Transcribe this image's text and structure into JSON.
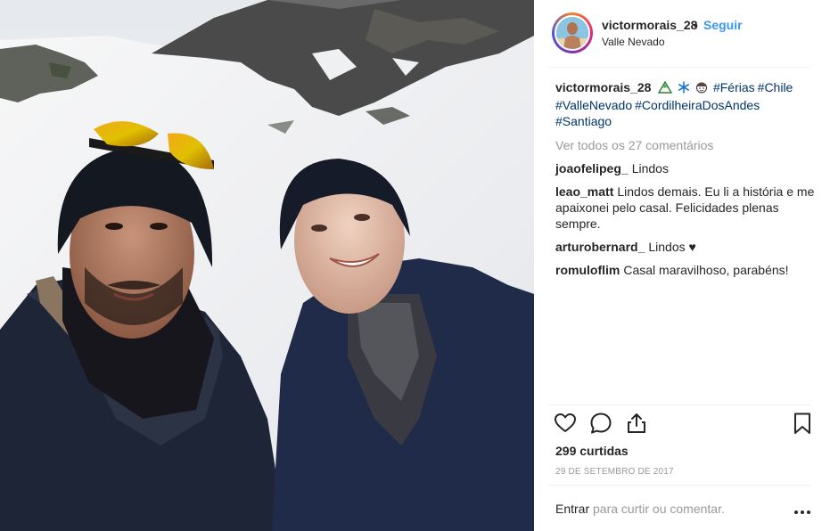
{
  "header": {
    "username": "victormorais_28",
    "separator": "•",
    "follow_label": "Seguir",
    "location": "Valle Nevado"
  },
  "caption": {
    "username": "victormorais_28",
    "emojis": [
      "mountain-emoji",
      "snowflake-emoji",
      "man-emoji"
    ],
    "hashtags": [
      "#Férias",
      "#Chile",
      "#ValleNevado",
      "#CordilheiraDosAndes",
      "#Santiago"
    ]
  },
  "comments": {
    "view_all": "Ver todos os 27 comentários",
    "items": [
      {
        "user": "joaofelipeg_",
        "text": "Lindos"
      },
      {
        "user": "leao_matt",
        "text": "Lindos demais. Eu li a história e me apaixonei pelo casal. Felicidades plenas sempre."
      },
      {
        "user": "arturobernard_",
        "text": "Lindos ♥"
      },
      {
        "user": "romuloflim",
        "text": "Casal maravilhoso, parabéns!"
      }
    ]
  },
  "actions": {
    "icons": [
      "heart-icon",
      "comment-icon",
      "share-icon",
      "bookmark-icon"
    ]
  },
  "likes": "299 curtidas",
  "date": "29 de setembro de 2017",
  "add_comment": {
    "enter_label": "Entrar",
    "rest": "para curtir ou comentar."
  },
  "more_icon": "…",
  "colors": {
    "link_blue": "#3897f0",
    "hashtag": "#003569",
    "muted": "#999999",
    "text": "#262626"
  }
}
